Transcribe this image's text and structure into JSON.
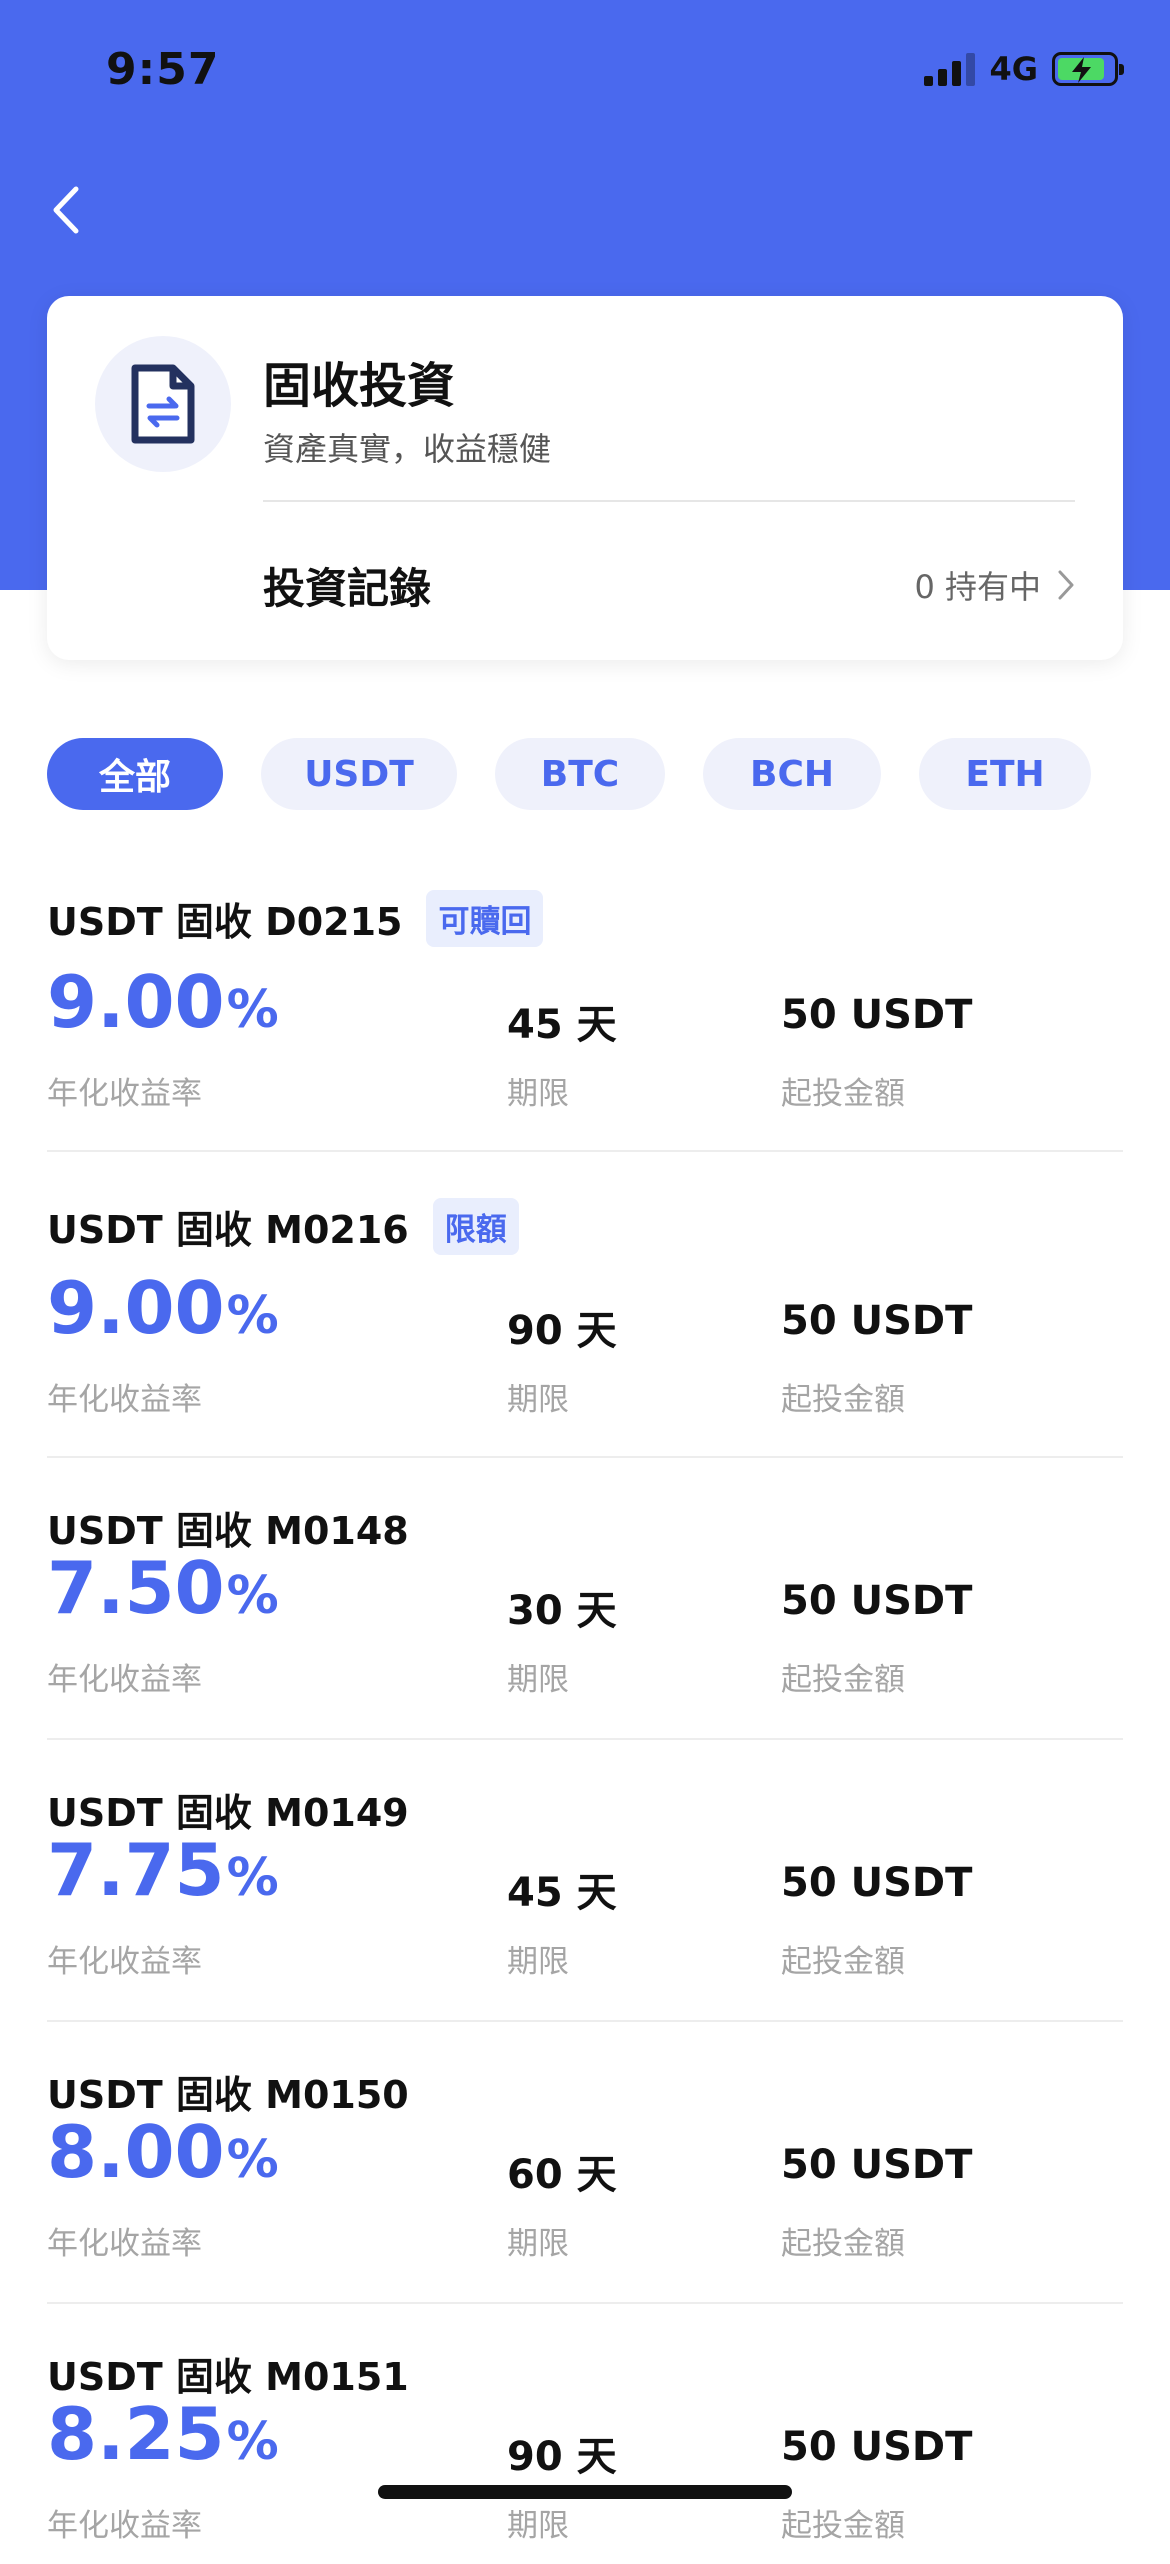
{
  "status_bar": {
    "time": "9:57",
    "network": "4G"
  },
  "header": {
    "title": "固收投資",
    "subtitle": "資產真實，收益穩健",
    "record_label": "投資記錄",
    "holding": "0 持有中"
  },
  "tabs": [
    {
      "label": "全部",
      "active": true
    },
    {
      "label": "USDT",
      "active": false
    },
    {
      "label": "BTC",
      "active": false
    },
    {
      "label": "BCH",
      "active": false
    },
    {
      "label": "ETH",
      "active": false
    }
  ],
  "labels": {
    "rate": "年化收益率",
    "term": "期限",
    "min": "起投金額",
    "percent": "%"
  },
  "products": [
    {
      "name": "USDT 固收 D0215",
      "badge": "可贖回",
      "rate": "9.00",
      "term": "45 天",
      "min": "50 USDT"
    },
    {
      "name": "USDT 固收 M0216",
      "badge": "限額",
      "rate": "9.00",
      "term": "90 天",
      "min": "50 USDT"
    },
    {
      "name": "USDT 固收 M0148",
      "badge": "",
      "rate": "7.50",
      "term": "30 天",
      "min": "50 USDT"
    },
    {
      "name": "USDT 固收 M0149",
      "badge": "",
      "rate": "7.75",
      "term": "45 天",
      "min": "50 USDT"
    },
    {
      "name": "USDT 固收 M0150",
      "badge": "",
      "rate": "8.00",
      "term": "60 天",
      "min": "50 USDT"
    },
    {
      "name": "USDT 固收 M0151",
      "badge": "",
      "rate": "8.25",
      "term": "90 天",
      "min": "50 USDT"
    }
  ],
  "colors": {
    "accent": "#4A69EE",
    "badge_bg": "#E9EEFD",
    "muted": "#A5A5A5"
  }
}
